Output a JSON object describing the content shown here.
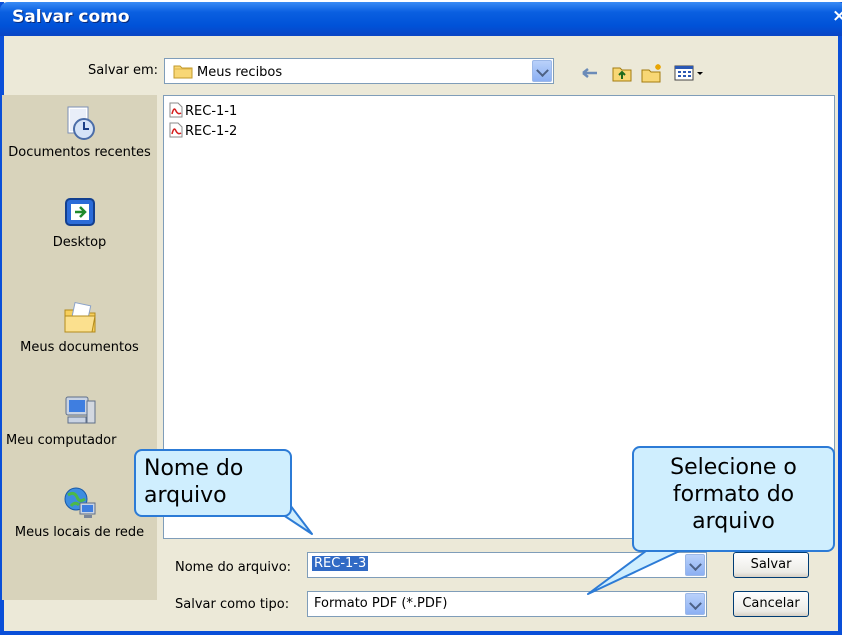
{
  "window": {
    "title": "Salvar como",
    "close_glyph": "×"
  },
  "lookin": {
    "label": "Salvar em:",
    "value": "Meus recibos",
    "folder_icon": "folder-icon"
  },
  "toolbar": {
    "back_icon": "back-arrow-icon",
    "up_icon": "up-folder-icon",
    "new_folder_icon": "new-folder-icon",
    "views_icon": "views-menu-icon"
  },
  "places": [
    {
      "label": "Documentos recentes",
      "icon": "recent-documents-icon"
    },
    {
      "label": "Desktop",
      "icon": "desktop-icon"
    },
    {
      "label": "Meus documentos",
      "icon": "my-documents-icon"
    },
    {
      "label": "Meu computador",
      "icon": "my-computer-icon"
    },
    {
      "label": "Meus locais de rede",
      "icon": "network-places-icon"
    }
  ],
  "files": [
    {
      "name": "REC-1-1",
      "icon": "pdf-file-icon"
    },
    {
      "name": "REC-1-2",
      "icon": "pdf-file-icon"
    }
  ],
  "filename": {
    "label": "Nome do arquivo:",
    "value": "REC-1-3"
  },
  "filetype": {
    "label": "Salvar como tipo:",
    "value": "Formato PDF (*.PDF)"
  },
  "buttons": {
    "save": "Salvar",
    "cancel": "Cancelar"
  },
  "callouts": {
    "filename": "Nome do arquivo",
    "filetype": "Selecione o formato do arquivo"
  },
  "colors": {
    "title_bar": "#0052d8",
    "window_bg": "#ece9d8",
    "places_bg": "#d8d3bb",
    "callout_bg": "#cfeefe",
    "callout_border": "#2c7bd6",
    "selection": "#316ac5"
  }
}
